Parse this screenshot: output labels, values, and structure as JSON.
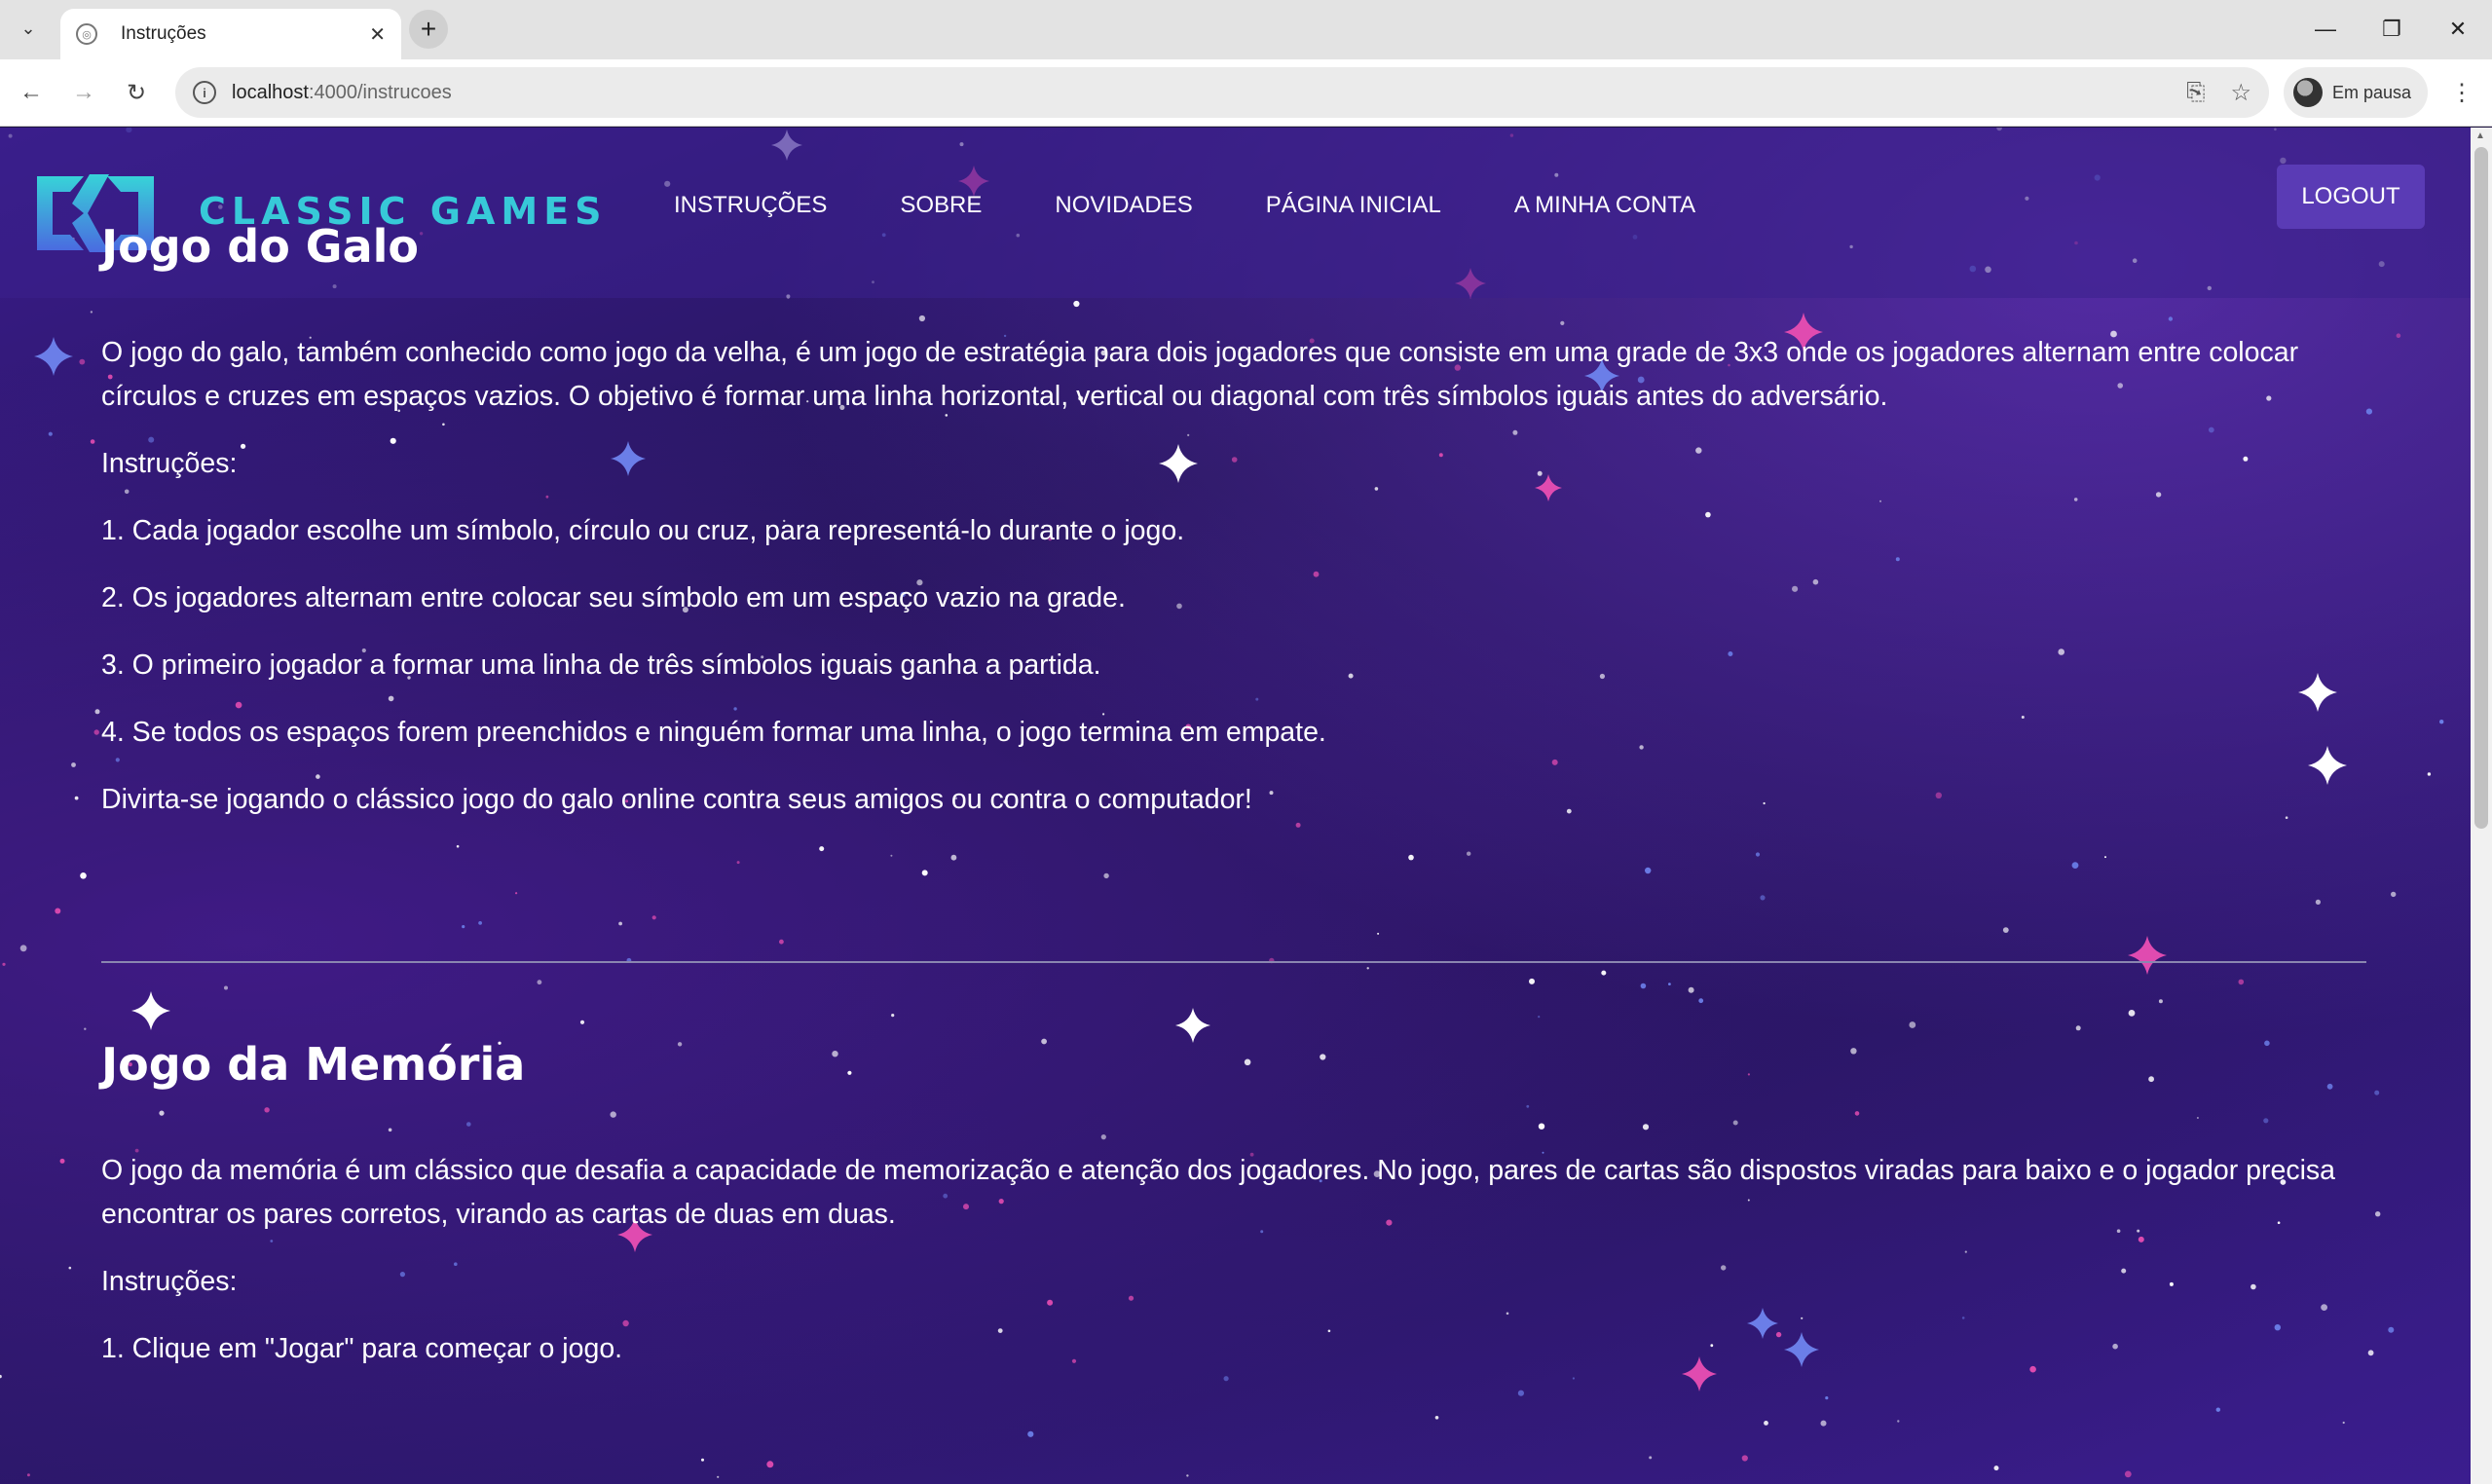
{
  "browser": {
    "tab_title": "Instruções",
    "url_host": "localhost",
    "url_path": ":4000/instrucoes",
    "profile_label": "Em pausa"
  },
  "site": {
    "brand": "CLASSIC GAMES",
    "nav": [
      "INSTRUÇÕES",
      "SOBRE",
      "NOVIDADES",
      "PÁGINA INICIAL",
      "A MINHA CONTA"
    ],
    "logout_label": "LOGOUT",
    "brand_color": "#37c9d8",
    "accent_color": "#5a3bb5"
  },
  "sections": [
    {
      "title": "Jogo do Galo",
      "description": "O jogo do galo, também conhecido como jogo da velha, é um jogo de estratégia para dois jogadores que consiste em uma grade de 3x3 onde os jogadores alternam entre colocar círculos e cruzes em espaços vazios. O objetivo é formar uma linha horizontal, vertical ou diagonal com três símbolos iguais antes do adversário.",
      "label": "Instruções:",
      "steps": [
        "1. Cada jogador escolhe um símbolo, círculo ou cruz, para representá-lo durante o jogo.",
        "2. Os jogadores alternam entre colocar seu símbolo em um espaço vazio na grade.",
        "3. O primeiro jogador a formar uma linha de três símbolos iguais ganha a partida.",
        "4. Se todos os espaços forem preenchidos e ninguém formar uma linha, o jogo termina em empate."
      ],
      "outro": "Divirta-se jogando o clássico jogo do galo online contra seus amigos ou contra o computador!"
    },
    {
      "title": "Jogo da Memória",
      "description": "O jogo da memória é um clássico que desafia a capacidade de memorização e atenção dos jogadores. No jogo, pares de cartas são dispostos viradas para baixo e o jogador precisa encontrar os pares corretos, virando as cartas de duas em duas.",
      "label": "Instruções:",
      "steps": [
        "1. Clique em \"Jogar\" para começar o jogo."
      ]
    }
  ]
}
